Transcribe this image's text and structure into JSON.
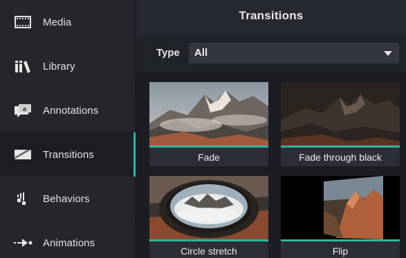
{
  "sidebar": {
    "items": [
      {
        "label": "Media",
        "icon": "film-icon"
      },
      {
        "label": "Library",
        "icon": "books-icon"
      },
      {
        "label": "Annotations",
        "icon": "speech-bubble-icon"
      },
      {
        "label": "Transitions",
        "icon": "transition-icon",
        "active": true
      },
      {
        "label": "Behaviors",
        "icon": "behaviors-icon"
      },
      {
        "label": "Animations",
        "icon": "arrow-animation-icon"
      }
    ]
  },
  "panel": {
    "title": "Transitions",
    "type_label": "Type",
    "type_value": "All"
  },
  "transitions": [
    {
      "label": "Fade"
    },
    {
      "label": "Fade through black"
    },
    {
      "label": "Circle stretch"
    },
    {
      "label": "Flip"
    }
  ],
  "colors": {
    "accent": "#2fb79a",
    "sidebar_bg": "#25272d",
    "panel_bg": "#1b1d22"
  }
}
